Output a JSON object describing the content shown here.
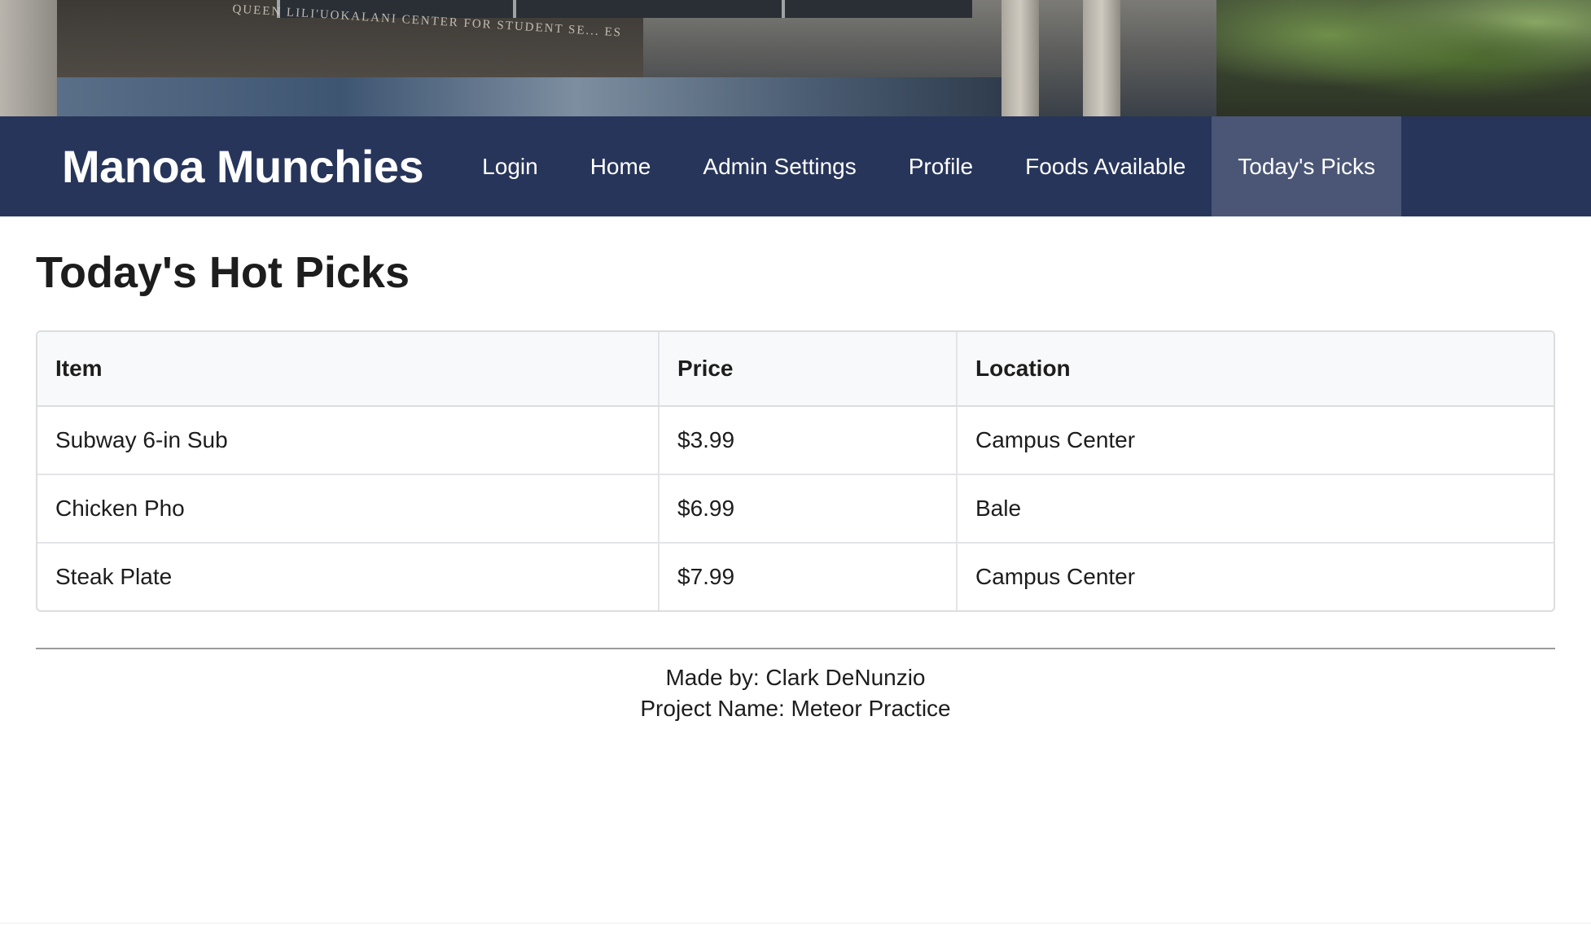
{
  "banner": {
    "sign_text": "QUEEN LILI'UOKALANI CENTER FOR STUDENT SE... ES"
  },
  "navbar": {
    "brand": "Manoa Munchies",
    "items": [
      {
        "label": "Login"
      },
      {
        "label": "Home"
      },
      {
        "label": "Admin Settings"
      },
      {
        "label": "Profile"
      },
      {
        "label": "Foods Available"
      },
      {
        "label": "Today's Picks",
        "active": true
      }
    ],
    "background_color": "#27355a",
    "active_color": "#4b5676"
  },
  "main": {
    "title": "Today's Hot Picks",
    "table": {
      "headers": [
        "Item",
        "Price",
        "Location"
      ],
      "rows": [
        [
          "Subway 6-in Sub",
          "$3.99",
          "Campus Center"
        ],
        [
          "Chicken Pho",
          "$6.99",
          "Bale"
        ],
        [
          "Steak Plate",
          "$7.99",
          "Campus Center"
        ]
      ]
    }
  },
  "footer": {
    "line1": "Made by: Clark DeNunzio",
    "line2": "Project Name: Meteor Practice"
  }
}
